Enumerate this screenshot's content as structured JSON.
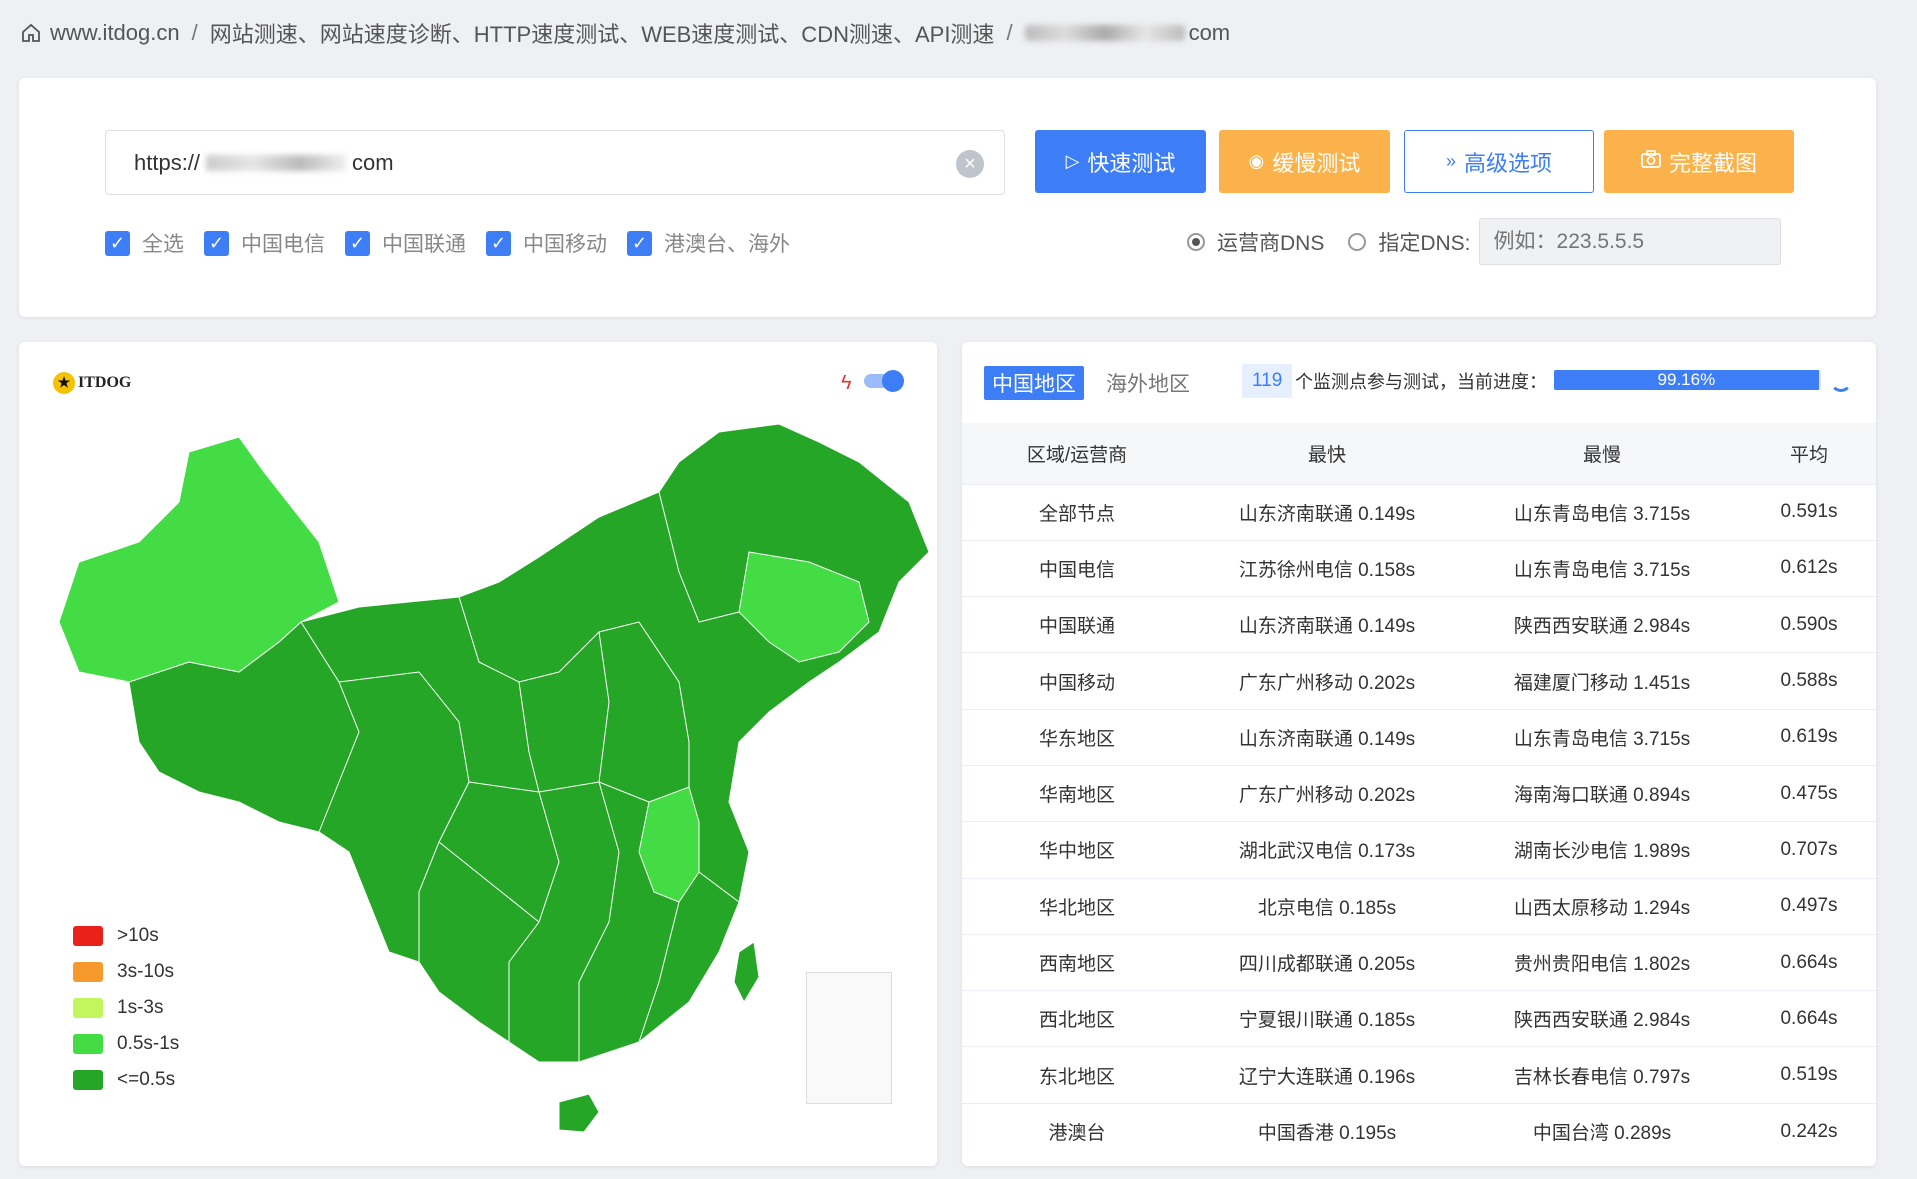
{
  "breadcrumb": {
    "home": "www.itdog.cn",
    "section": "网站测速、网站速度诊断、HTTP速度测试、WEB速度测试、CDN测速、API测速",
    "current_suffix": "com"
  },
  "search": {
    "prefix": "https://",
    "suffix": "com"
  },
  "buttons": {
    "fast": "快速测试",
    "slow": "缓慢测试",
    "advanced": "高级选项",
    "screenshot": "完整截图"
  },
  "checkboxes": [
    {
      "label": "全选",
      "checked": true
    },
    {
      "label": "中国电信",
      "checked": true
    },
    {
      "label": "中国联通",
      "checked": true
    },
    {
      "label": "中国移动",
      "checked": true
    },
    {
      "label": "港澳台、海外",
      "checked": true
    }
  ],
  "dns": {
    "option_isp": "运营商DNS",
    "option_custom": "指定DNS:",
    "placeholder": "例如：223.5.5.5",
    "selected": "isp"
  },
  "map": {
    "logo_text": "ITDOG",
    "legend": [
      {
        "label": ">10s",
        "color": "#e8221b"
      },
      {
        "label": "3s-10s",
        "color": "#f79a2e"
      },
      {
        "label": "1s-3s",
        "color": "#c3f55c"
      },
      {
        "label": "0.5s-1s",
        "color": "#44dc44"
      },
      {
        "label": "<=0.5s",
        "color": "#26a626"
      }
    ]
  },
  "results": {
    "tabs": [
      "中国地区",
      "海外地区"
    ],
    "active_tab": 0,
    "node_count": "119",
    "progress_label": "个监测点参与测试，当前进度：",
    "progress_text": "99.16%",
    "progress_value": 99.16,
    "columns": [
      "区域/运营商",
      "最快",
      "最慢",
      "平均"
    ],
    "rows": [
      [
        "全部节点",
        "山东济南联通 0.149s",
        "山东青岛电信 3.715s",
        "0.591s"
      ],
      [
        "中国电信",
        "江苏徐州电信 0.158s",
        "山东青岛电信 3.715s",
        "0.612s"
      ],
      [
        "中国联通",
        "山东济南联通 0.149s",
        "陕西西安联通 2.984s",
        "0.590s"
      ],
      [
        "中国移动",
        "广东广州移动 0.202s",
        "福建厦门移动 1.451s",
        "0.588s"
      ],
      [
        "华东地区",
        "山东济南联通 0.149s",
        "山东青岛电信 3.715s",
        "0.619s"
      ],
      [
        "华南地区",
        "广东广州移动 0.202s",
        "海南海口联通 0.894s",
        "0.475s"
      ],
      [
        "华中地区",
        "湖北武汉电信 0.173s",
        "湖南长沙电信 1.989s",
        "0.707s"
      ],
      [
        "华北地区",
        "北京电信 0.185s",
        "山西太原移动 1.294s",
        "0.497s"
      ],
      [
        "西南地区",
        "四川成都联通 0.205s",
        "贵州贵阳电信 1.802s",
        "0.664s"
      ],
      [
        "西北地区",
        "宁夏银川联通 0.185s",
        "陕西西安联通 2.984s",
        "0.664s"
      ],
      [
        "东北地区",
        "辽宁大连联通 0.196s",
        "吉林长春电信 0.797s",
        "0.519s"
      ],
      [
        "港澳台",
        "中国香港 0.195s",
        "中国台湾 0.289s",
        "0.242s"
      ]
    ]
  }
}
